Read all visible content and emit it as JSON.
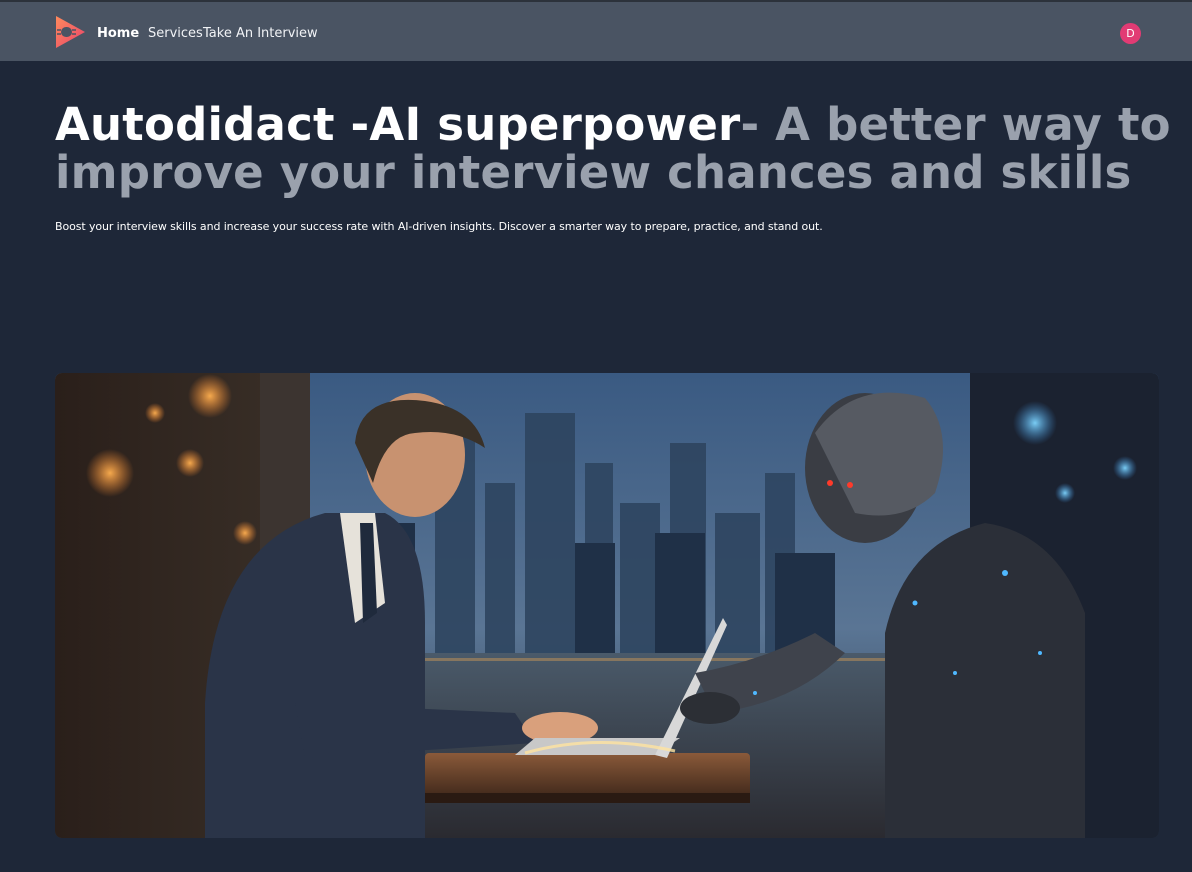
{
  "nav": {
    "home": "Home",
    "services": "Services",
    "take_interview": "Take An Interview",
    "avatar_initial": "D"
  },
  "hero": {
    "title_strong": "Autodidact -AI superpower",
    "title_muted": "- A better way to improve your interview chances and skills",
    "subtitle": "Boost your interview skills and increase your success rate with AI-driven insights. Discover a smarter way to prepare, practice, and stand out."
  },
  "theme": {
    "background": "#1e2738",
    "header": "#4a5463",
    "logo_gradient": [
      "#ff7a59",
      "#e8436b"
    ],
    "avatar": "#e23b74"
  },
  "icons": {
    "logo": "play-mic-logo-icon",
    "avatar": "user-avatar-icon"
  }
}
